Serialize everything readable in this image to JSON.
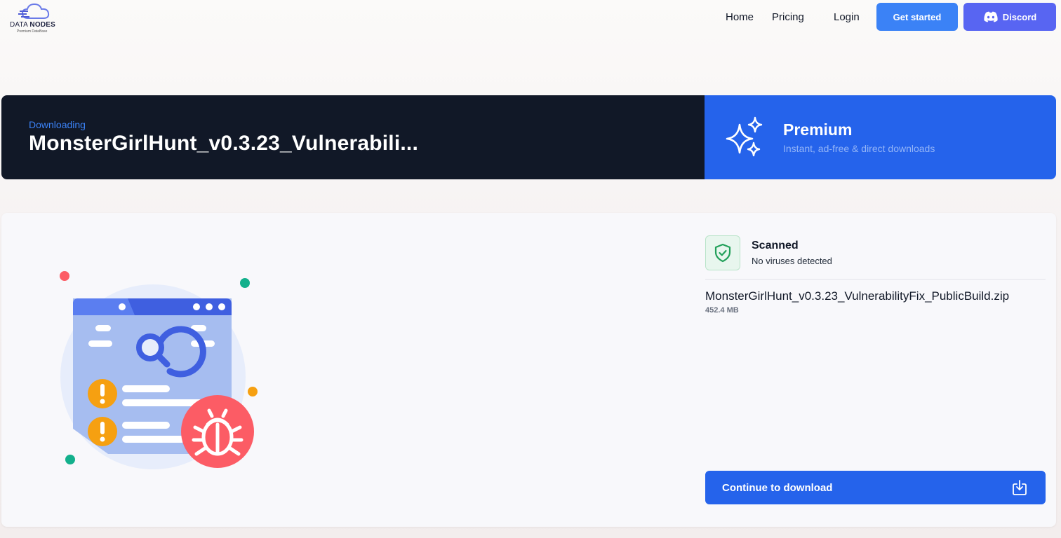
{
  "header": {
    "logo_text_light": "DATA",
    "logo_text_bold": "NODES",
    "logo_tagline": "Premium DataBase",
    "nav": [
      {
        "label": "Home"
      },
      {
        "label": "Pricing"
      },
      {
        "label": "Login"
      }
    ],
    "get_started_label": "Get started",
    "discord_label": "Discord"
  },
  "banner": {
    "status": "Downloading",
    "filename_truncated": "MonsterGirlHunt_v0.3.23_Vulnerabili...",
    "premium_title": "Premium",
    "premium_subtitle": "Instant, ad-free & direct downloads"
  },
  "scan": {
    "title": "Scanned",
    "subtitle": "No viruses detected"
  },
  "file": {
    "name": "MonsterGirlHunt_v0.3.23_VulnerabilityFix_PublicBuild.zip",
    "size": "452.4 MB"
  },
  "actions": {
    "continue_label": "Continue to download"
  },
  "colors": {
    "primary_blue": "#2563eb",
    "accent_blue": "#3b82f6",
    "discord": "#5865f2",
    "dark_banner": "#111827",
    "scan_green": "#22a05a",
    "bug_red": "#fc5c65",
    "warning_orange": "#f6a011"
  }
}
